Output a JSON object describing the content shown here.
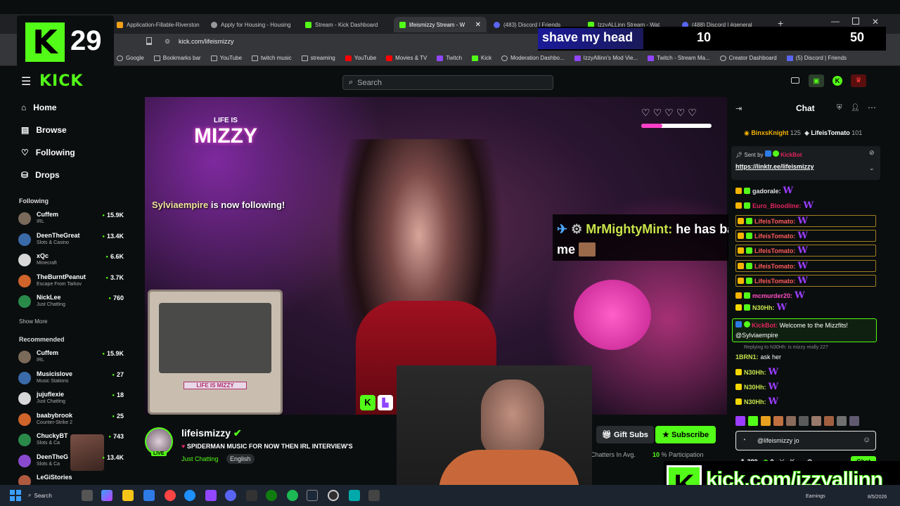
{
  "overlay": {
    "counter": "29",
    "banner_text": "shave my head",
    "banner_count": "10",
    "banner_goal": "50",
    "bottom_url": "kick.com/izzyallinn"
  },
  "browser": {
    "tabs": [
      "Application-Fillable-Riverston",
      "Apply for Housing - Housing",
      "Stream - Kick Dashboard",
      "lifeismizzy Stream - W",
      "(483) Discord | Friends",
      "IzzyALLinn Stream - Wat",
      "(488) Discord | #general"
    ],
    "url": "kick.com/lifeismizzy",
    "bookmarks": [
      "Google",
      "Bookmarks bar",
      "YouTube",
      "twitch music",
      "streaming",
      "YouTube",
      "Movies & TV",
      "Twitch",
      "Kick",
      "Moderation Dashbo...",
      "IzzyAllinn's Mod Vie...",
      "Twitch - Stream Ma...",
      "Creator Dashboard",
      "(5) Discord | Friends"
    ]
  },
  "header": {
    "logo": "KICK",
    "search_placeholder": "Search"
  },
  "sidebar": {
    "nav": [
      "Home",
      "Browse",
      "Following",
      "Drops"
    ],
    "following_title": "Following",
    "following": [
      {
        "name": "Cuffem",
        "category": "IRL",
        "viewers": "15.9K"
      },
      {
        "name": "DeenTheGreat",
        "category": "Slots & Casino",
        "viewers": "13.4K"
      },
      {
        "name": "xQc",
        "category": "Minecraft",
        "viewers": "6.6K"
      },
      {
        "name": "TheBurntPeanut",
        "category": "Escape From Tarkov",
        "viewers": "3.7K"
      },
      {
        "name": "NickLee",
        "category": "Just Chatting",
        "viewers": "760"
      }
    ],
    "show_more": "Show More",
    "recommended_title": "Recommended",
    "recommended": [
      {
        "name": "Cuffem",
        "category": "IRL",
        "viewers": "15.9K"
      },
      {
        "name": "Musicislove",
        "category": "Music Stations",
        "viewers": "27"
      },
      {
        "name": "jujuflexie",
        "category": "Just Chatting",
        "viewers": "18"
      },
      {
        "name": "baabybrook",
        "category": "Counter-Strike 2",
        "viewers": "25"
      },
      {
        "name": "ChuckyBT",
        "category": "Slots & Ca",
        "viewers": "743"
      },
      {
        "name": "DeenTheG",
        "category": "Slots & Ca",
        "viewers": "13.4K"
      },
      {
        "name": "LeGiStories",
        "category": "",
        "viewers": ""
      }
    ]
  },
  "video": {
    "logo_text": "MIZZY",
    "logo_small": "LIFE IS",
    "follow_user": "Sylviaempire",
    "follow_text": "is now following!",
    "highlight_user": "MrMightyMint:",
    "highlight_msg": "he has bad pick up lines trust me",
    "monitor_label": "LIFE IS MIZZY"
  },
  "stream_info": {
    "streamer": "lifeismizzy",
    "title": "SPIDERMAN MUSIC FOR NOW THEN IRL INTERVIEW'S",
    "category": "Just Chatting",
    "language": "English",
    "live": "LIVE",
    "gift_subs": "Gift Subs",
    "subscribe": "Subscribe",
    "stats": "Chatters In Avg.",
    "participation_value": "10",
    "participation_label": "% Participation"
  },
  "chat": {
    "title": "Chat",
    "top_gifters": [
      {
        "name": "BinxsKnight",
        "count": "125"
      },
      {
        "name": "LifeisTomato",
        "count": "101"
      }
    ],
    "pinned_sender_label": "Sent by",
    "pinned_sender": "KickBot",
    "pinned_link": "https://linktr.ee/lifeismizzy",
    "messages": [
      {
        "user": "gadorale:",
        "color": "#e0e0e0",
        "hl": false
      },
      {
        "user": "Euro_Bloodline:",
        "color": "#e0245e",
        "hl": false
      },
      {
        "user": "LifeisTomato:",
        "color": "#ff5a5a",
        "hl": true
      },
      {
        "user": "LifeisTomato:",
        "color": "#ff5a5a",
        "hl": true
      },
      {
        "user": "LifeisTomato:",
        "color": "#ff5a5a",
        "hl": true
      },
      {
        "user": "LifeisTomato:",
        "color": "#ff5a5a",
        "hl": true
      },
      {
        "user": "LifeisTomato:",
        "color": "#ff5a5a",
        "hl": true
      },
      {
        "user": "mcmurder20:",
        "color": "#ff4ec4",
        "hl": false
      }
    ],
    "n30hh_1": "N30Hh:",
    "welcome_user": "KickBot:",
    "welcome_msg": "Welcome to the Mizzfits!",
    "welcome_mention": "@Sylviaempire",
    "reply_context": "Replying to N30Hh: is mizzy really 22?",
    "reply_user": "1BRN1:",
    "reply_msg": "ask her",
    "n30hh_lines": [
      "N30Hh:",
      "N30Hh:",
      "N30Hh:"
    ],
    "input_value": "@lifeismizzy jo",
    "points": "380",
    "kick_points": "0",
    "send": "Chat"
  },
  "taskbar": {
    "search": "Search",
    "earnings": "Earnings",
    "date": "8/5/2026"
  }
}
